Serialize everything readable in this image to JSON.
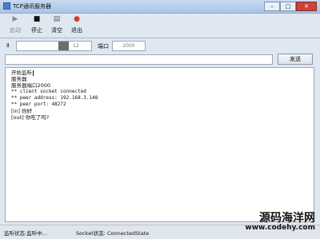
{
  "window": {
    "title": "TCP通讯服务器"
  },
  "toolbar": {
    "start": "启动",
    "stop": "停止",
    "clear": "清空",
    "exit": "退出"
  },
  "config": {
    "ip_label": "Ⅱ",
    "ip_value": "12",
    "port_label": "端口",
    "port_value": "2000"
  },
  "send": {
    "button_label": "发送",
    "input_value": ""
  },
  "log": {
    "lines": [
      "开始监听",
      "服务器",
      "服务器端口2000",
      "** client socket connected",
      "** peer address: 192.168.3.148",
      "** peer port: 48272",
      "[in] 你好",
      "[out] 你吃了吗?"
    ]
  },
  "status": {
    "listen": "监听状态:监听中...",
    "socket": "Socket状态: ConnectedState"
  },
  "watermark": {
    "line1": "源码海洋网",
    "line2": "www.codehy.com"
  },
  "colors": {
    "titlebar": "#a9c3e6",
    "close_button": "#c9443d",
    "exit_icon": "#d33b2c"
  }
}
